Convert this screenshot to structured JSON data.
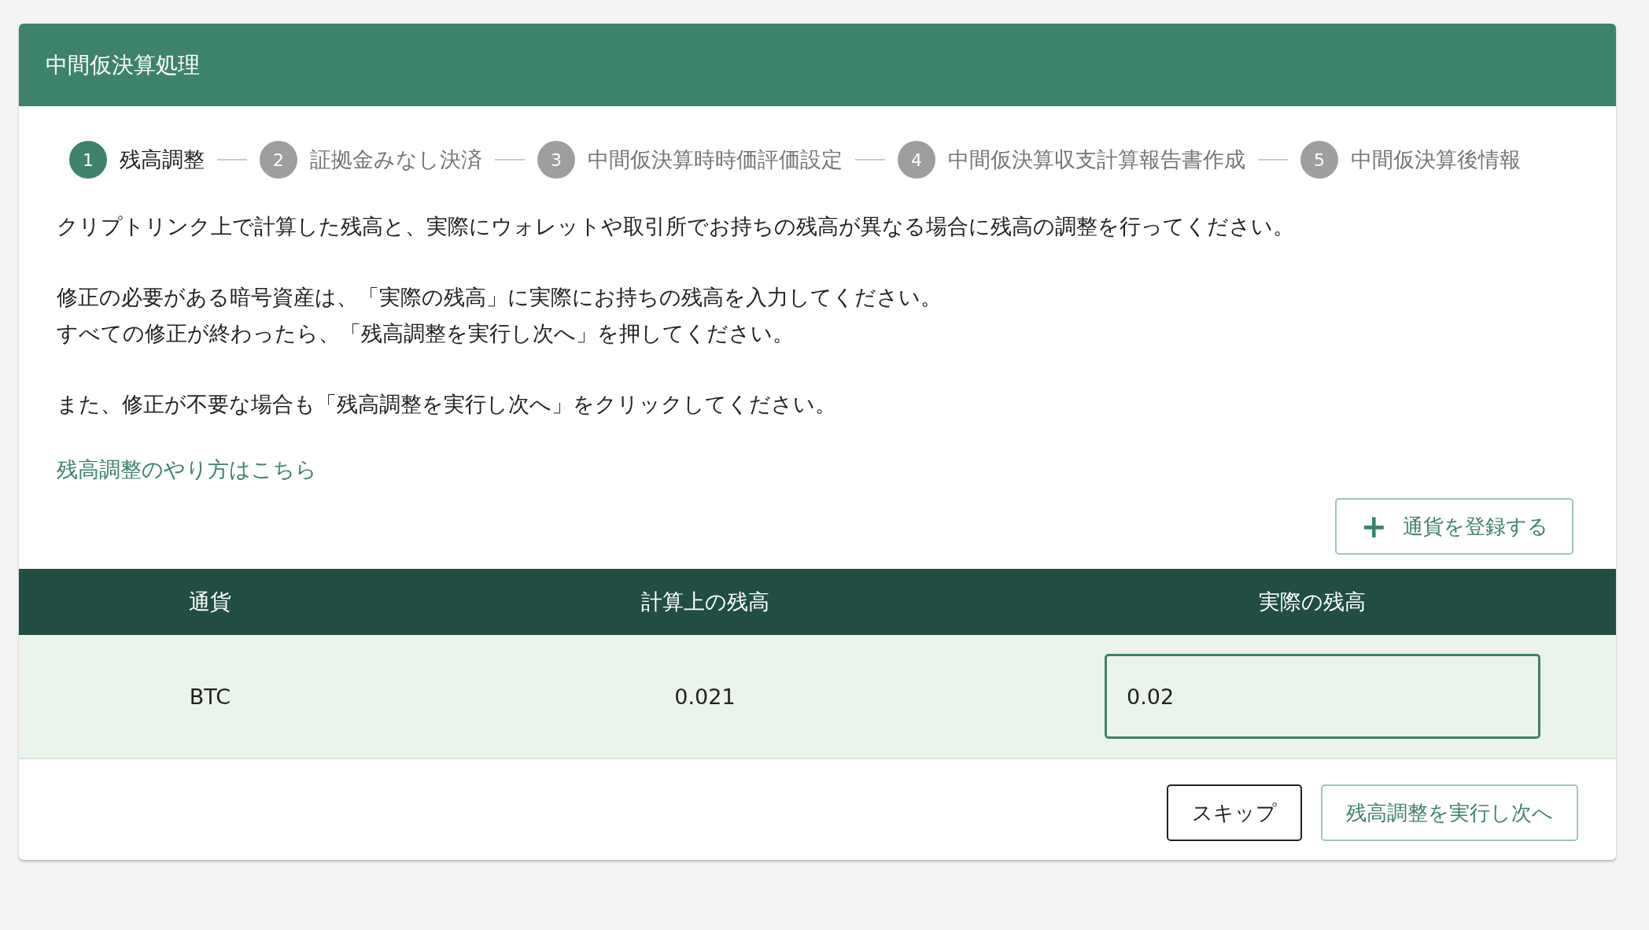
{
  "dialog": {
    "title": "中間仮決算処理"
  },
  "steps": [
    {
      "number": "1",
      "label": "残高調整",
      "selected": true
    },
    {
      "number": "2",
      "label": "証拠金みなし決済",
      "selected": false
    },
    {
      "number": "3",
      "label": "中間仮決算時時価評価設定",
      "selected": false
    },
    {
      "number": "4",
      "label": "中間仮決算収支計算報告書作成",
      "selected": false
    },
    {
      "number": "5",
      "label": "中間仮決算後情報",
      "selected": false
    }
  ],
  "paragraphs": [
    [
      "クリプトリンク上で計算した残高と、実際にウォレットや取引所でお持ちの残高が異なる場合に残高の調整を行ってください。"
    ],
    [
      "修正の必要がある暗号資産は、「実際の残高」に実際にお持ちの残高を入力してください。",
      "すべての修正が終わったら、「残高調整を実行し次へ」を押してください。"
    ],
    [
      "また、修正が不要な場合も「残高調整を実行し次へ」をクリックしてください。"
    ]
  ],
  "help_link": "残高調整のやり方はこちら",
  "add_button": {
    "icon": "+",
    "label": "通貨を登録する"
  },
  "table": {
    "columns": [
      "通貨",
      "計算上の残高",
      "実際の残高"
    ],
    "rows": [
      {
        "currency": "BTC",
        "calculated": "0.021",
        "actual": "0.02"
      }
    ]
  },
  "buttons": [
    {
      "kind": "secondary",
      "label": "スキップ"
    },
    {
      "kind": "primary",
      "label": "残高調整を実行し次へ"
    }
  ]
}
